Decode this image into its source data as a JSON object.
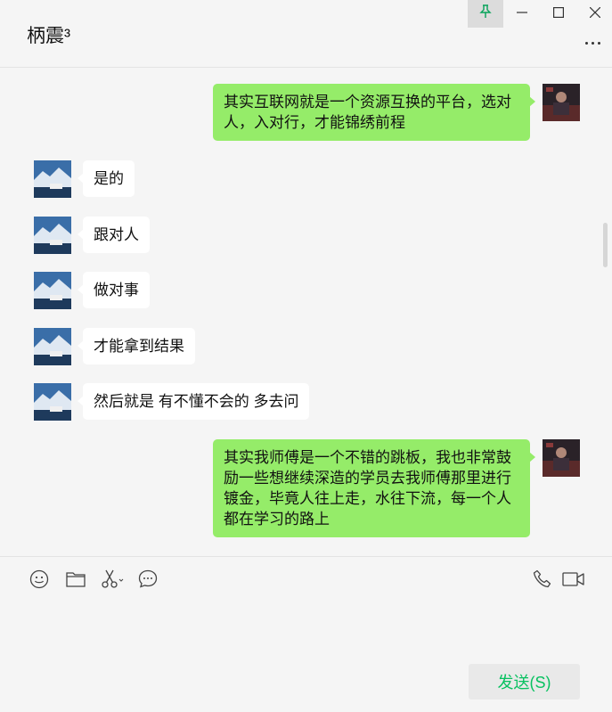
{
  "window": {
    "title": "柄震³",
    "controls": [
      "pin-icon",
      "minimize-icon",
      "maximize-icon",
      "close-icon"
    ],
    "more_icon": "more-icon"
  },
  "messages": [
    {
      "sender": "me",
      "text": "其实互联网就是一个资源互换的平台，选对人，入对行，才能锦绣前程"
    },
    {
      "sender": "other",
      "text": "是的"
    },
    {
      "sender": "other",
      "text": "跟对人"
    },
    {
      "sender": "other",
      "text": "做对事"
    },
    {
      "sender": "other",
      "text": "才能拿到结果"
    },
    {
      "sender": "other",
      "text": "然后就是 有不懂不会的 多去问"
    },
    {
      "sender": "me",
      "text": "其实我师傅是一个不错的跳板，我也非常鼓励一些想继续深造的学员去我师傅那里进行镀金，毕竟人往上走，水往下流，每一个人都在学习的路上"
    }
  ],
  "toolbar": {
    "left_icons": [
      "emoji-icon",
      "folder-icon",
      "scissors-icon",
      "chat-bubble-icon"
    ],
    "right_icons": [
      "phone-icon",
      "video-icon"
    ]
  },
  "send_button": {
    "label": "发送(S)"
  },
  "colors": {
    "my_bubble": "#95ec69",
    "other_bubble": "#ffffff",
    "background": "#f5f5f5",
    "send_text": "#07c160"
  }
}
